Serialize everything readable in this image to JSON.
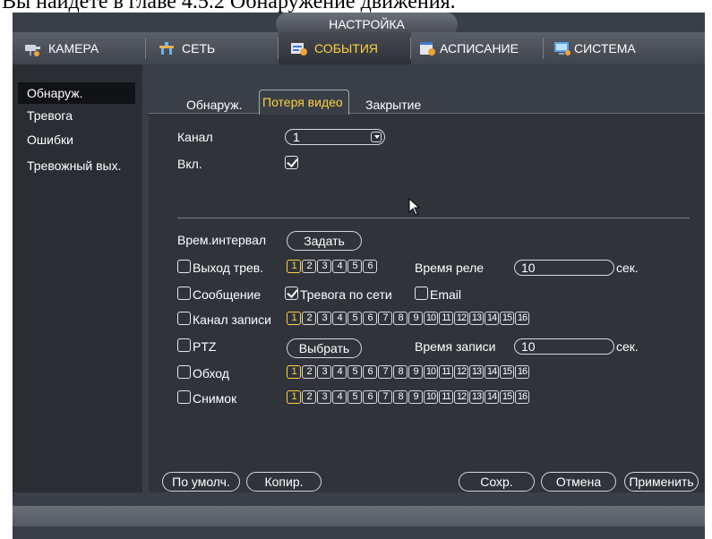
{
  "caption": "Вы найдете в главе 4.5.2 Обнаружение движения.",
  "window": {
    "title": "НАСТРОЙКА"
  },
  "tabs": [
    {
      "label": "КАМЕРА",
      "icon": "camera-icon"
    },
    {
      "label": "СЕТЬ",
      "icon": "network-icon"
    },
    {
      "label": "СОБЫТИЯ",
      "icon": "events-icon",
      "active": true
    },
    {
      "label": "АСПИСАНИЕ",
      "icon": "schedule-icon"
    },
    {
      "label": "СИСТЕМА",
      "icon": "system-icon"
    }
  ],
  "sidebar": {
    "items": [
      {
        "label": "Обнаруж.",
        "active": true
      },
      {
        "label": "Тревога"
      },
      {
        "label": "Ошибки"
      },
      {
        "label": "Тревожный вых."
      }
    ]
  },
  "subtabs": [
    {
      "label": "Обнаруж."
    },
    {
      "label": "Потеря видео",
      "active": true
    },
    {
      "label": "Закрытие"
    }
  ],
  "form": {
    "channel_label": "Канал",
    "channel_value": "1",
    "enable_label": "Вкл.",
    "enable_checked": true,
    "schedule_label": "Врем.интервал",
    "schedule_button": "Задать",
    "alarm_out_label": "Выход трев.",
    "alarm_out_numbers": [
      "1",
      "2",
      "3",
      "4",
      "5",
      "6"
    ],
    "relay_time_label": "Время реле",
    "relay_time_value": "10",
    "sec_label": "сек.",
    "message_label": "Сообщение",
    "net_alarm_label": "Тревога по сети",
    "net_alarm_checked": true,
    "email_label": "Email",
    "record_channel_label": "Канал записи",
    "ptz_label": "PTZ",
    "ptz_button": "Выбрать",
    "record_time_label": "Время записи",
    "record_time_value": "10",
    "tour_label": "Обход",
    "snapshot_label": "Снимок",
    "channels_16": [
      "1",
      "2",
      "3",
      "4",
      "5",
      "6",
      "7",
      "8",
      "9",
      "10",
      "11",
      "12",
      "13",
      "14",
      "15",
      "16"
    ]
  },
  "footer_buttons": {
    "default": "По умолч.",
    "copy": "Копир.",
    "save": "Сохр.",
    "cancel": "Отмена",
    "apply": "Применить"
  },
  "colors": {
    "accent": "#ffd23d",
    "panel": "#30333a",
    "background": "#3a3e47"
  }
}
